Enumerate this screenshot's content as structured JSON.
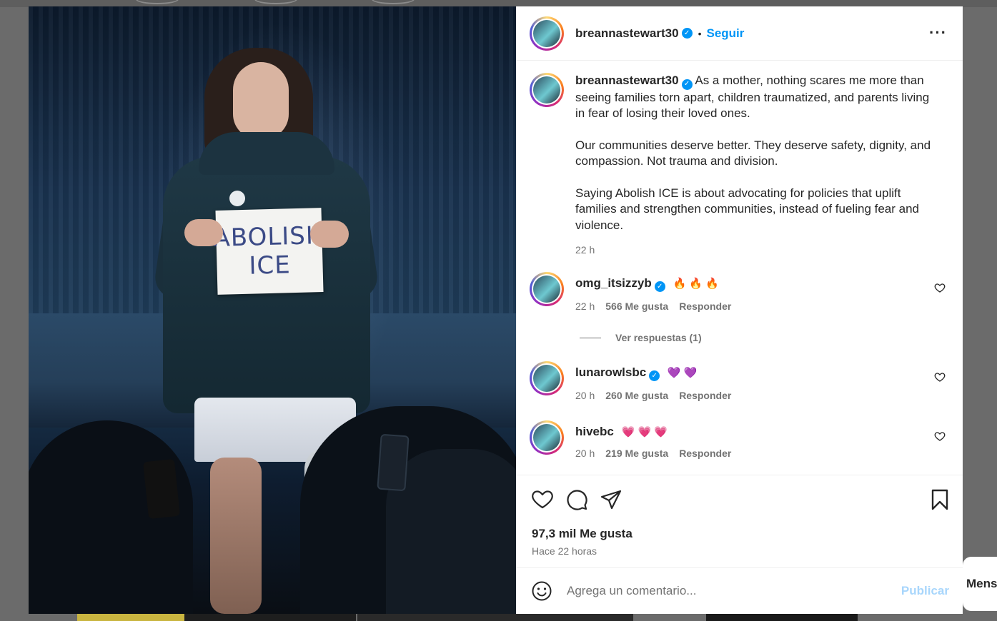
{
  "post": {
    "author": "breannastewart30",
    "follow_label": "Seguir",
    "separator": "•",
    "more_label": "···",
    "verified_mark": "✓",
    "image_sign_line1": "ABOLISH",
    "image_sign_line2": "ICE",
    "caption": {
      "para1": "As a mother, nothing scares me more than seeing families torn apart, children traumatized, and parents living in fear of losing their loved ones.",
      "para2": "Our communities deserve better. They deserve safety, dignity, and compassion. Not trauma and division.",
      "para3": "Saying Abolish ICE is about advocating for policies that uplift families and strengthen communities, instead of fueling fear and violence.",
      "time": "22 h"
    }
  },
  "comments": [
    {
      "user": "omg_itsizzyb",
      "verified": true,
      "text": "🔥 🔥 🔥",
      "time": "22 h",
      "likes": "566 Me gusta",
      "reply_label": "Responder",
      "avatar_icon": "avatar-icon"
    },
    {
      "user": "lunarowlsbc",
      "verified": true,
      "text": "💜 💜",
      "time": "20 h",
      "likes": "260 Me gusta",
      "reply_label": "Responder",
      "avatar_icon": "avatar-icon"
    },
    {
      "user": "hivebc",
      "verified": false,
      "text": "💗 💗 💗",
      "time": "20 h",
      "likes": "219 Me gusta",
      "reply_label": "Responder",
      "avatar_icon": "avatar-icon"
    }
  ],
  "view_replies": "Ver respuestas (1)",
  "actions": {
    "likes": "97,3 mil Me gusta",
    "posted_ago": "Hace 22 horas",
    "icons": [
      "heart-icon",
      "comment-icon",
      "share-icon",
      "bookmark-icon"
    ]
  },
  "composer": {
    "placeholder": "Agrega un comentario...",
    "publish_label": "Publicar",
    "emoji_icon": "smiley-icon"
  },
  "side_chip": "Mens",
  "colors": {
    "accent": "#0095f6",
    "text": "#262626",
    "muted": "#737373",
    "publish_disabled": "#a8d6fc"
  }
}
